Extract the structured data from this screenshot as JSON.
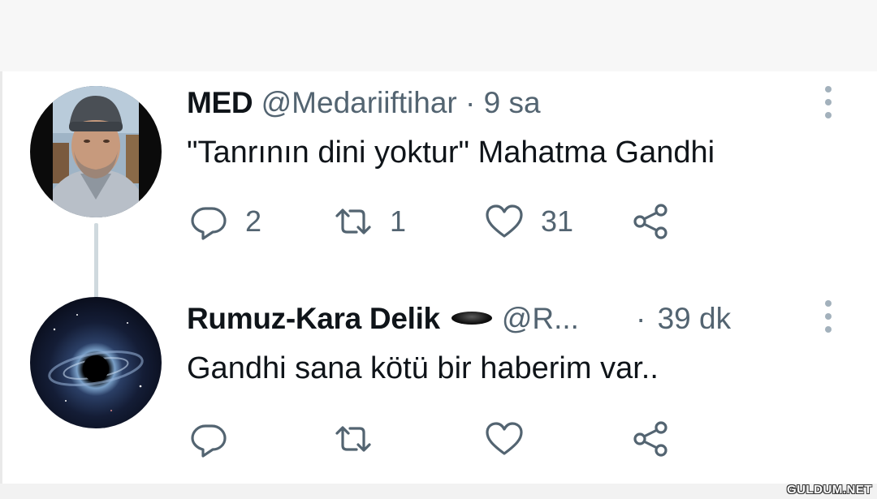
{
  "tweets": [
    {
      "name": "MED",
      "handle": "@Medariiftihar",
      "separator": "·",
      "time": "9 sa",
      "text": "\"Tanrının dini yoktur\" Mahatma Gandhi",
      "reply_count": "2",
      "retweet_count": "1",
      "like_count": "31"
    },
    {
      "name": "Rumuz-Kara Delik",
      "handle": "@R...",
      "separator": "·",
      "time": "39 dk",
      "text": "Gandhi sana kötü bir haberim var..",
      "reply_count": "",
      "retweet_count": "",
      "like_count": ""
    }
  ],
  "icons": {
    "reply": "reply-icon",
    "retweet": "retweet-icon",
    "like": "heart-icon",
    "share": "share-icon",
    "more": "more-vertical-icon"
  },
  "colors": {
    "text_primary": "#0f1419",
    "text_secondary": "#536471",
    "thread_line": "#cfd9de"
  },
  "watermark": "GULDUM.NET"
}
